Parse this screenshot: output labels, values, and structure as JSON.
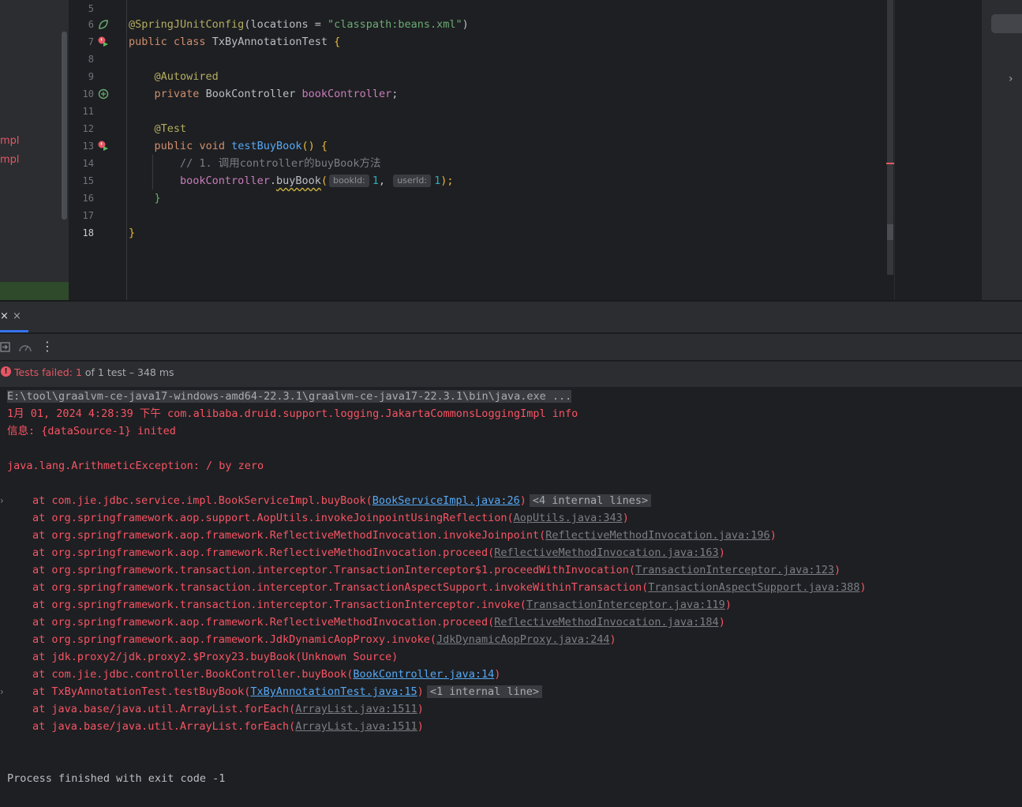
{
  "editor": {
    "sidebar_items": [
      "mpl",
      "mpl"
    ],
    "line_numbers": [
      "5",
      "6",
      "7",
      "8",
      "9",
      "10",
      "11",
      "12",
      "13",
      "14",
      "15",
      "16",
      "17",
      "18"
    ],
    "code": {
      "l6_annotation": "@SpringJUnitConfig",
      "l6_open": "(locations = ",
      "l6_string": "\"classpath:beans.xml\"",
      "l6_close": ")",
      "l7_public": "public",
      "l7_class": "class",
      "l7_name": "TxByAnnotationTest",
      "l7_brace": "{",
      "l9_annotation": "@Autowired",
      "l10_private": "private",
      "l10_type": "BookController",
      "l10_field": "bookController",
      "l10_semi": ";",
      "l12_annotation": "@Test",
      "l13_public": "public",
      "l13_void": "void",
      "l13_method": "testBuyBook",
      "l13_parens": "()",
      "l13_brace": "{",
      "l14_comment": "// 1. 调用controller的buyBook方法",
      "l15_field": "bookController",
      "l15_dot": ".",
      "l15_method": "buyBook",
      "l15_open": "(",
      "l15_hint1": "bookId:",
      "l15_arg1": "1",
      "l15_comma": ",",
      "l15_hint2": "userId:",
      "l15_arg2": "1",
      "l15_close": ");",
      "l16_brace": "}",
      "l18_brace": "}"
    }
  },
  "tool_window": {
    "tab_close": "×",
    "status": {
      "prefix": "Tests failed:",
      "failed_count": "1",
      "suffix": "of 1 test – 348 ms"
    }
  },
  "console": {
    "command": "E:\\tool\\graalvm-ce-java17-windows-amd64-22.3.1\\graalvm-ce-java17-22.3.1\\bin\\java.exe ...",
    "log1": "1月 01, 2024 4:28:39 下午 com.alibaba.druid.support.logging.JakartaCommonsLoggingImpl info",
    "log2": "信息: {dataSource-1} inited",
    "exception": "java.lang.ArithmeticException: / by zero",
    "trace": [
      {
        "text": "at com.jie.jdbc.service.impl.BookServiceImpl.buyBook(",
        "link": "BookServiceImpl.java:26",
        "internal": "<4 internal lines>"
      },
      {
        "text": "at org.springframework.aop.support.AopUtils.invokeJoinpointUsingReflection(",
        "link": "AopUtils.java:343"
      },
      {
        "text": "at org.springframework.aop.framework.ReflectiveMethodInvocation.invokeJoinpoint(",
        "link": "ReflectiveMethodInvocation.java:196"
      },
      {
        "text": "at org.springframework.aop.framework.ReflectiveMethodInvocation.proceed(",
        "link": "ReflectiveMethodInvocation.java:163"
      },
      {
        "text": "at org.springframework.transaction.interceptor.TransactionInterceptor$1.proceedWithInvocation(",
        "link": "TransactionInterceptor.java:123"
      },
      {
        "text": "at org.springframework.transaction.interceptor.TransactionAspectSupport.invokeWithinTransaction(",
        "link": "TransactionAspectSupport.java:388"
      },
      {
        "text": "at org.springframework.transaction.interceptor.TransactionInterceptor.invoke(",
        "link": "TransactionInterceptor.java:119"
      },
      {
        "text": "at org.springframework.aop.framework.ReflectiveMethodInvocation.proceed(",
        "link": "ReflectiveMethodInvocation.java:184"
      },
      {
        "text": "at org.springframework.aop.framework.JdkDynamicAopProxy.invoke(",
        "link": "JdkDynamicAopProxy.java:244"
      },
      {
        "text": "at jdk.proxy2/jdk.proxy2.$Proxy23.buyBook(Unknown Source)"
      },
      {
        "text": "at com.jie.jdbc.controller.BookController.buyBook(",
        "link": "BookController.java:14"
      },
      {
        "text": "at TxByAnnotationTest.testBuyBook(",
        "link": "TxByAnnotationTest.java:15",
        "internal": "<1 internal line>"
      },
      {
        "text": "at java.base/java.util.ArrayList.forEach(",
        "link": "ArrayList.java:1511"
      },
      {
        "text": "at java.base/java.util.ArrayList.forEach(",
        "link": "ArrayList.java:1511"
      }
    ],
    "paren_close": ")",
    "exit": "Process finished with exit code -1"
  }
}
